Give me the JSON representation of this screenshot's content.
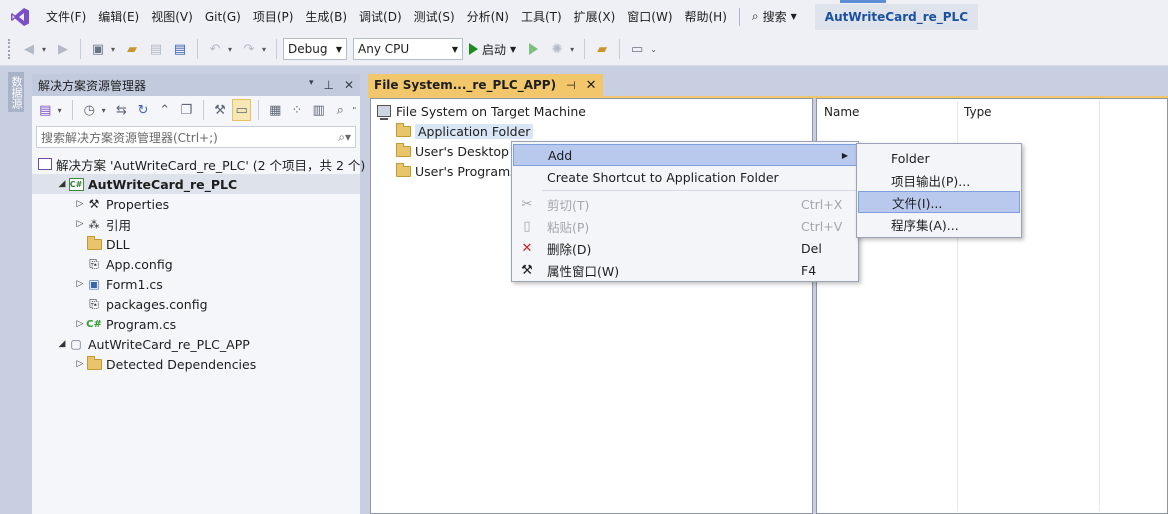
{
  "menubar": {
    "items": [
      "文件(F)",
      "编辑(E)",
      "视图(V)",
      "Git(G)",
      "项目(P)",
      "生成(B)",
      "调试(D)",
      "测试(S)",
      "分析(N)",
      "工具(T)",
      "扩展(X)",
      "窗口(W)",
      "帮助(H)"
    ],
    "search_label": "搜索",
    "title": "AutWriteCard_re_PLC"
  },
  "toolbar": {
    "config": "Debug",
    "platform": "Any CPU",
    "start_label": "启动"
  },
  "left_strip": {
    "tab_label": "数据源"
  },
  "solution_explorer": {
    "title": "解决方案资源管理器",
    "search_placeholder": "搜索解决方案资源管理器(Ctrl+;)",
    "tree": [
      {
        "label": "解决方案 'AutWriteCard_re_PLC' (2 个项目，共 2 个)",
        "icon": "solution-icon",
        "indent": 0,
        "arrow": ""
      },
      {
        "label": "AutWriteCard_re_PLC",
        "icon": "csproj-icon",
        "indent": 1,
        "arrow": "expanded",
        "bold": true,
        "selected": true
      },
      {
        "label": "Properties",
        "icon": "wrench-icon",
        "indent": 2,
        "arrow": "collapsed"
      },
      {
        "label": "引用",
        "icon": "references-icon",
        "indent": 2,
        "arrow": "collapsed"
      },
      {
        "label": "DLL",
        "icon": "folder-icon",
        "indent": 2,
        "arrow": ""
      },
      {
        "label": "App.config",
        "icon": "config-file-icon",
        "indent": 2,
        "arrow": ""
      },
      {
        "label": "Form1.cs",
        "icon": "form-icon",
        "indent": 2,
        "arrow": "collapsed"
      },
      {
        "label": "packages.config",
        "icon": "config-file-icon",
        "indent": 2,
        "arrow": ""
      },
      {
        "label": "Program.cs",
        "icon": "csharp-file-icon",
        "indent": 2,
        "arrow": "collapsed"
      },
      {
        "label": "AutWriteCard_re_PLC_APP",
        "icon": "setup-project-icon",
        "indent": 1,
        "arrow": "expanded"
      },
      {
        "label": "Detected Dependencies",
        "icon": "folder-icon",
        "indent": 2,
        "arrow": "collapsed"
      }
    ]
  },
  "document": {
    "tab_title": "File System..._re_PLC_APP)",
    "tree": {
      "root": "File System on Target Machine",
      "folders": [
        "Application Folder",
        "User's Desktop",
        "User's Programs"
      ]
    },
    "columns": [
      "Name",
      "Type"
    ]
  },
  "context_menu": {
    "items": [
      {
        "label": "Add",
        "shortcut": "",
        "has_submenu": true,
        "highlighted": true
      },
      {
        "label": "Create Shortcut to Application Folder",
        "shortcut": ""
      },
      {
        "label": "剪切(T)",
        "shortcut": "Ctrl+X",
        "disabled": true
      },
      {
        "label": "粘贴(P)",
        "shortcut": "Ctrl+V",
        "disabled": true
      },
      {
        "label": "删除(D)",
        "shortcut": "Del"
      },
      {
        "label": "属性窗口(W)",
        "shortcut": "F4"
      }
    ]
  },
  "submenu": {
    "items": [
      "Folder",
      "项目输出(P)...",
      "文件(I)...",
      "程序集(A)..."
    ],
    "highlighted_index": 2
  }
}
